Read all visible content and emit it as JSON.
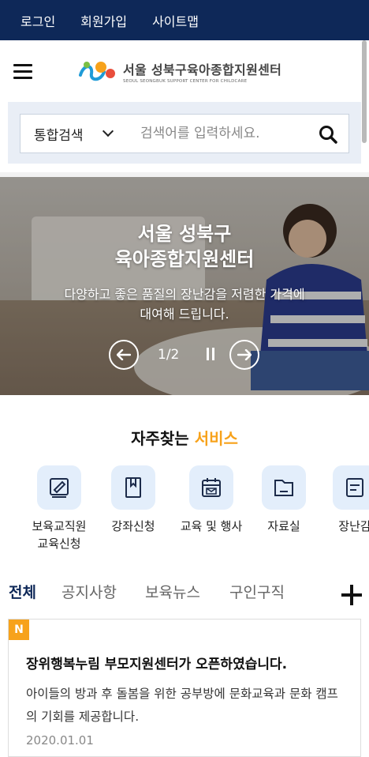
{
  "top_links": [
    "로그인",
    "회원가입",
    "사이트맵"
  ],
  "logo": {
    "main": "서울 성북구육아종합지원센터",
    "sub": "SEOUL SEONGBUK SUPPORT CENTER FOR CHILDCARE"
  },
  "search": {
    "category": "통합검색",
    "placeholder": "검색어를 입력하세요."
  },
  "banner": {
    "title_line1": "서울 성북구",
    "title_line2": "육아종합지원센터",
    "desc_line1": "다양하고 좋은 품질의 장난감을 저렴한 가격에",
    "desc_line2": "대여해 드립니다.",
    "pager": "1/2"
  },
  "services": {
    "title_prefix": "자주찾는",
    "title_accent": "서비스",
    "items": [
      {
        "line1": "보육교직원",
        "line2": "교육신청",
        "icon": "certificate-icon"
      },
      {
        "line1": "강좌신청",
        "line2": "",
        "icon": "book-icon"
      },
      {
        "line1": "교육 및 행사",
        "line2": "",
        "icon": "calendar-icon"
      },
      {
        "line1": "자료실",
        "line2": "",
        "icon": "folder-icon"
      },
      {
        "line1": "장난감",
        "line2": "",
        "icon": "toy-icon"
      }
    ]
  },
  "tabs": [
    "전체",
    "공지사항",
    "보육뉴스",
    "구인구직"
  ],
  "notice": {
    "badge": "N",
    "title": "장위행복누림 부모지원센터가 오픈하였습니다.",
    "desc": "아이들의 방과 후 돌봄을 위한 공부방에 문화교육과 문화 캠프의 기회를 제공합니다.",
    "date": "2020.01.01"
  },
  "colors": {
    "navy": "#0e2858",
    "accent": "#f7a21b",
    "icon_bg": "#e3eefb",
    "search_bg": "#e9eef6"
  }
}
